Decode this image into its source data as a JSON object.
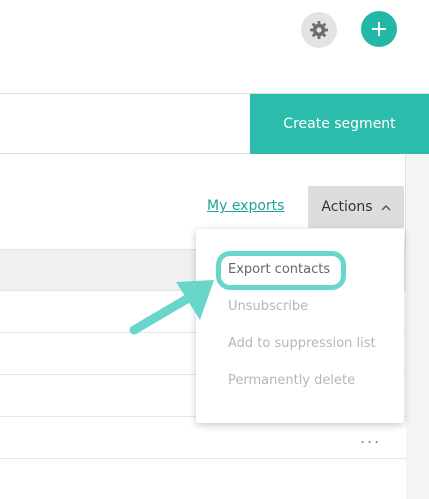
{
  "header": {
    "settings_icon": "gear-icon",
    "add_icon": "plus-icon",
    "accent_color": "#22b8a6"
  },
  "segment_bar": {
    "create_segment_label": "Create segment"
  },
  "toolbar": {
    "my_exports_label": "My exports",
    "actions_label": "Actions"
  },
  "actions_menu": {
    "items": [
      {
        "label": "Export contacts",
        "enabled": true,
        "highlighted": true
      },
      {
        "label": "Unsubscribe",
        "enabled": false
      },
      {
        "label": "Add to suppression list",
        "enabled": false
      },
      {
        "label": "Permanently delete",
        "enabled": false
      }
    ]
  },
  "table": {
    "row_menu_glyph": "..."
  }
}
